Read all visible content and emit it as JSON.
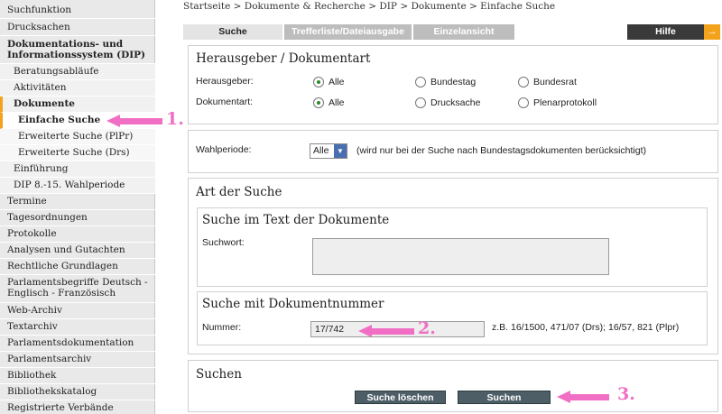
{
  "sidebar": {
    "items": [
      {
        "label": "Suchfunktion"
      },
      {
        "label": "Drucksachen"
      },
      {
        "label": "Dokumentations- und Informationssystem (DIP)"
      },
      {
        "label": "Beratungsabläufe"
      },
      {
        "label": "Aktivitäten"
      },
      {
        "label": "Dokumente"
      },
      {
        "label": "Einfache Suche"
      },
      {
        "label": "Erweiterte Suche (PlPr)"
      },
      {
        "label": "Erweiterte Suche (Drs)"
      },
      {
        "label": "Einführung"
      },
      {
        "label": "DIP 8.-15. Wahlperiode"
      },
      {
        "label": "Termine"
      },
      {
        "label": "Tagesordnungen"
      },
      {
        "label": "Protokolle"
      },
      {
        "label": "Analysen und Gutachten"
      },
      {
        "label": "Rechtliche Grundlagen"
      },
      {
        "label": "Parlamentsbegriffe Deutsch - Englisch - Französisch"
      },
      {
        "label": "Web-Archiv"
      },
      {
        "label": "Textarchiv"
      },
      {
        "label": "Parlamentsdokumentation"
      },
      {
        "label": "Parlamentsarchiv"
      },
      {
        "label": "Bibliothek"
      },
      {
        "label": "Bibliothekskatalog"
      },
      {
        "label": "Registrierte Verbände"
      }
    ]
  },
  "breadcrumb": "Startseite > Dokumente & Recherche > DIP > Dokumente > Einfache Suche",
  "tabs": [
    {
      "label": "Suche"
    },
    {
      "label": "Trefferliste/Dateiausgabe"
    },
    {
      "label": "Einzelansicht"
    }
  ],
  "help": {
    "label": "Hilfe",
    "arrow": "→"
  },
  "publisher_section": {
    "title": "Herausgeber / Dokumentart",
    "publisher_label": "Herausgeber:",
    "publisher_options": [
      "Alle",
      "Bundestag",
      "Bundesrat"
    ],
    "doctype_label": "Dokumentart:",
    "doctype_options": [
      "Alle",
      "Drucksache",
      "Plenarprotokoll"
    ]
  },
  "period_section": {
    "label": "Wahlperiode:",
    "selected": "Alle",
    "hint": "(wird nur bei der Suche nach Bundestagsdokumenten berücksichtigt)"
  },
  "search_type": {
    "title": "Art der Suche",
    "text_search": {
      "title": "Suche im Text der Dokumente",
      "keyword_label": "Suchwort:",
      "keyword_value": ""
    },
    "number_search": {
      "title": "Suche mit Dokumentnummer",
      "number_label": "Nummer:",
      "number_value": "17/742",
      "example": "z.B. 16/1500, 471/07 (Drs); 16/57, 821 (Plpr)"
    }
  },
  "search_section": {
    "title": "Suchen",
    "clear_label": "Suche löschen",
    "search_label": "Suchen"
  },
  "annotations": {
    "step1": "1.",
    "step2": "2.",
    "step3": "3."
  },
  "colors": {
    "accent": "#f3a21b",
    "annotation": "#f06fc4",
    "button": "#4e5e66",
    "radio_checked": "#2b8a2b"
  }
}
